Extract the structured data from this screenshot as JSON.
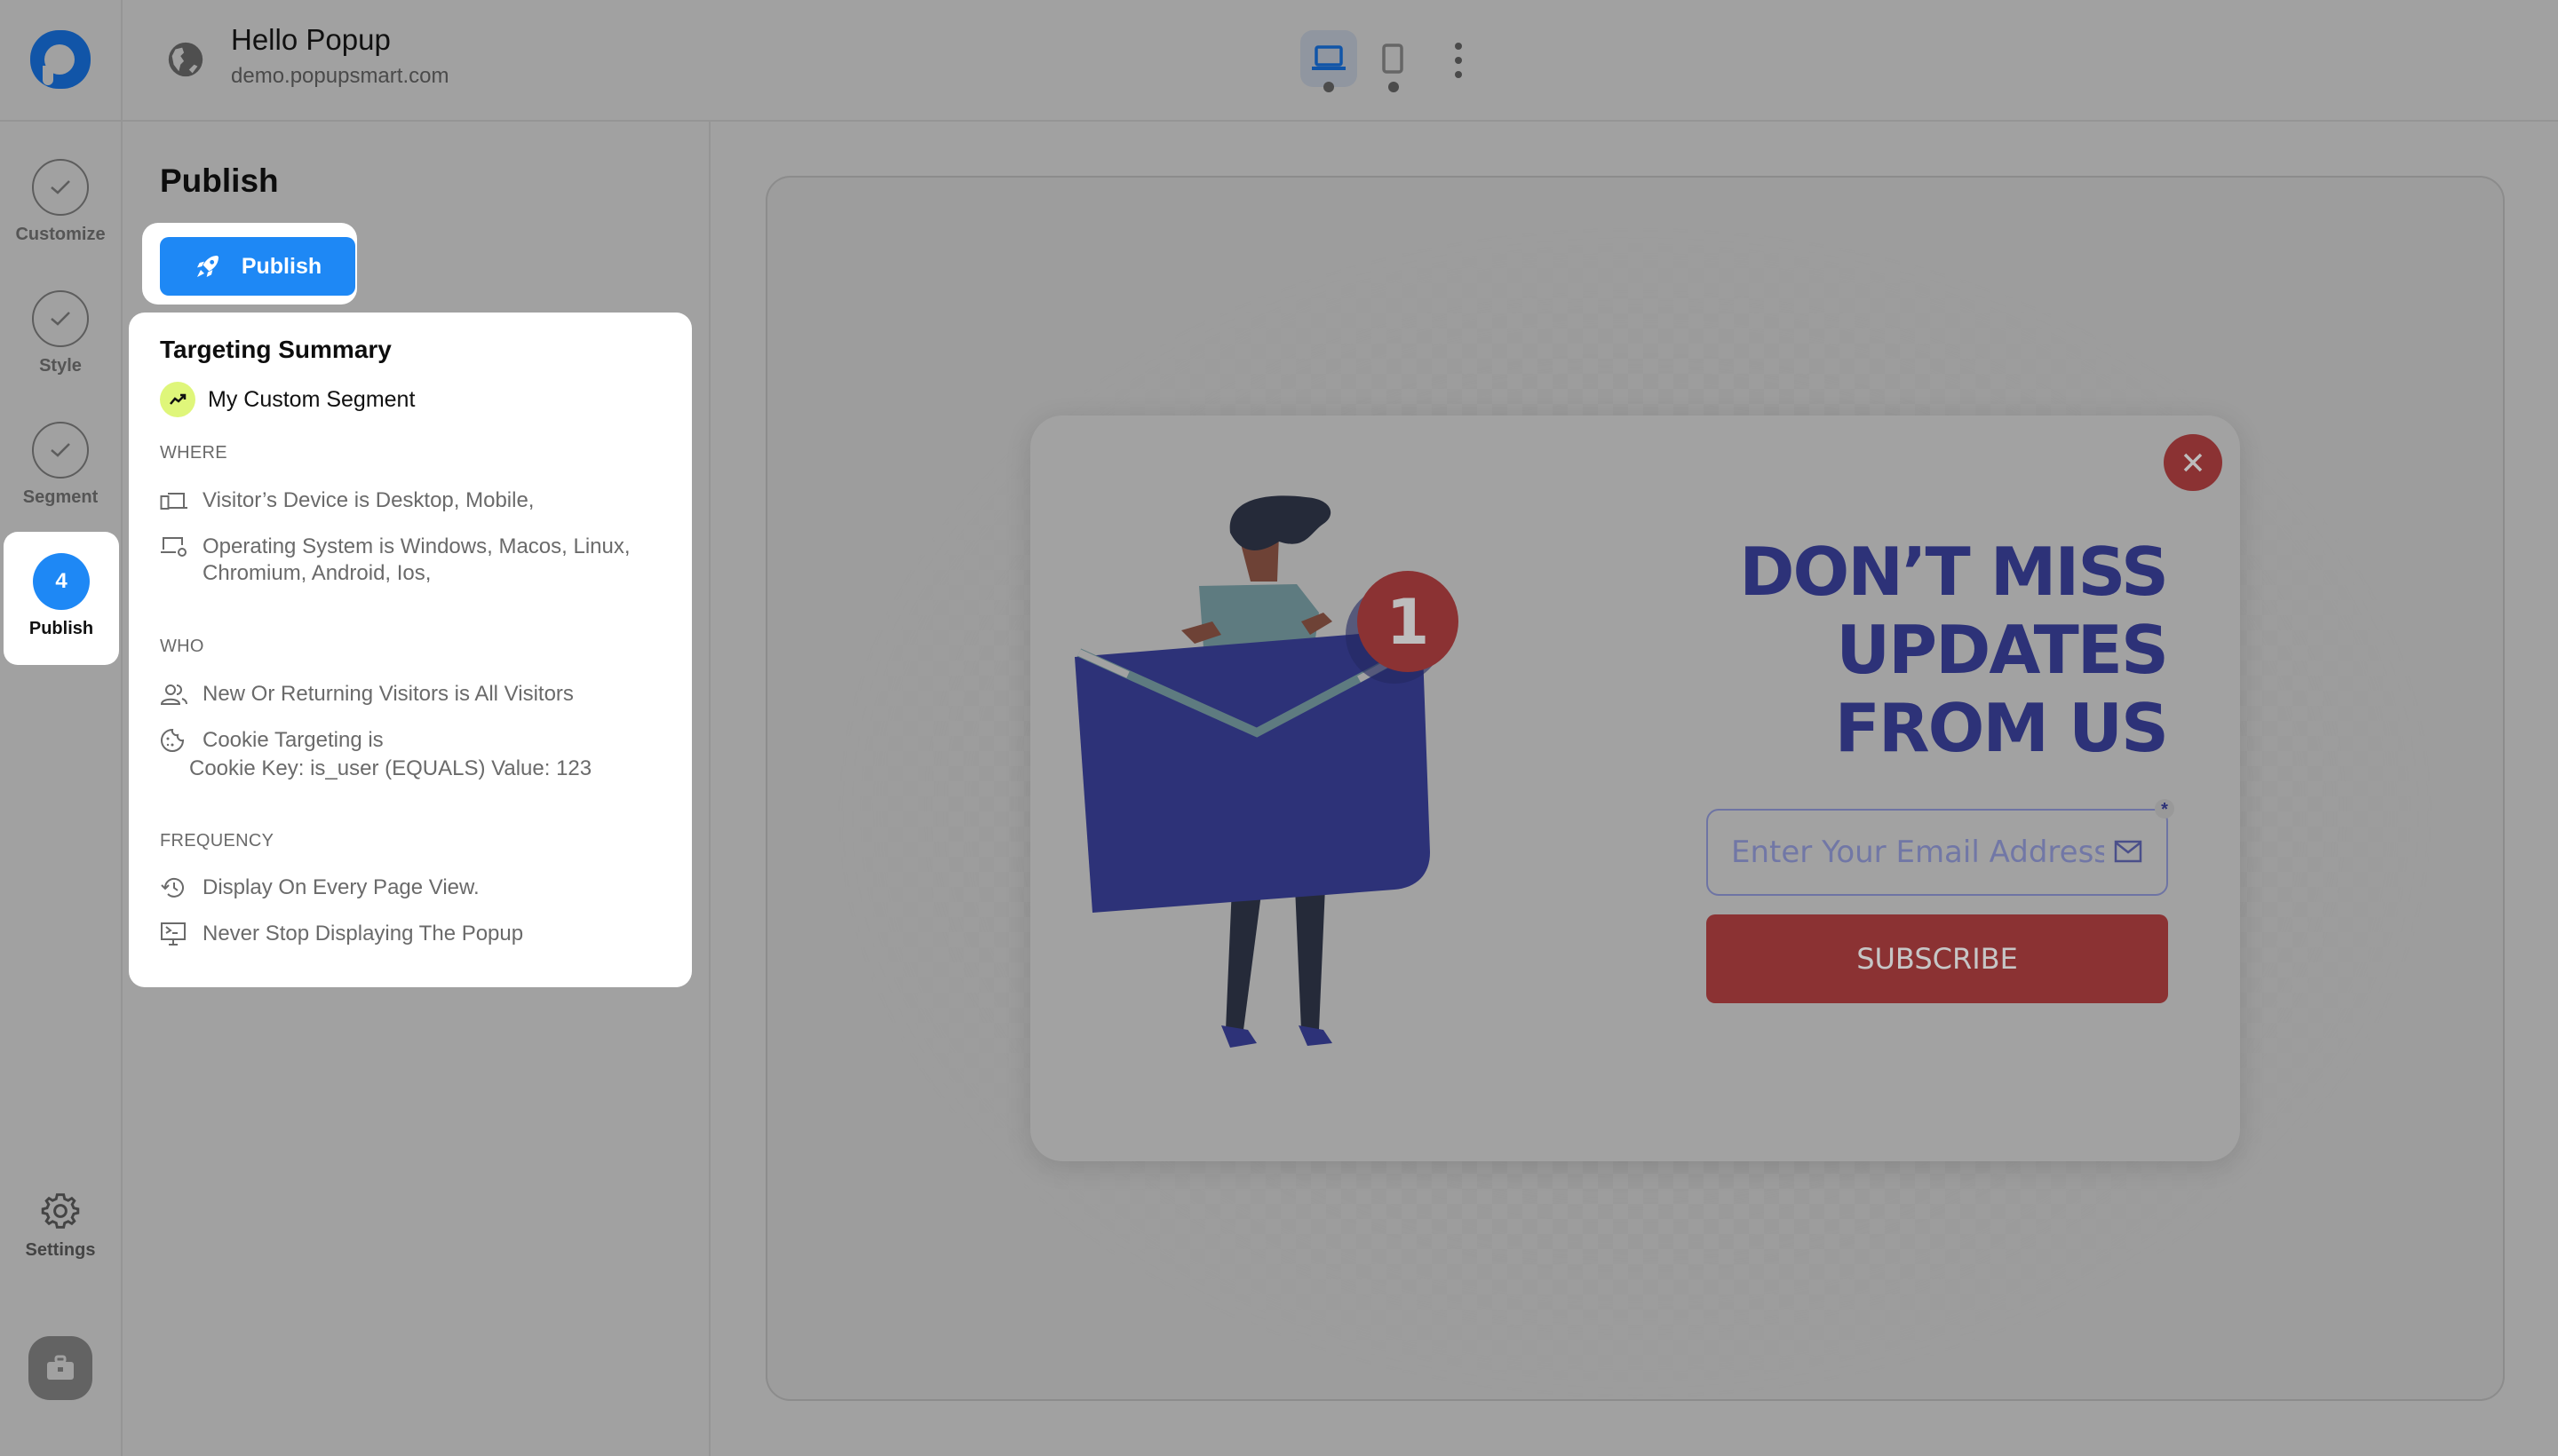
{
  "header": {
    "title": "Hello Popup",
    "url": "demo.popupsmart.com",
    "devices": [
      {
        "name": "desktop",
        "active": true
      },
      {
        "name": "mobile",
        "active": false
      }
    ]
  },
  "rail": {
    "steps": [
      {
        "label": "Customize",
        "state": "done"
      },
      {
        "label": "Style",
        "state": "done"
      },
      {
        "label": "Segment",
        "state": "done"
      },
      {
        "label": "Publish",
        "state": "active",
        "number": "4"
      }
    ],
    "settings_label": "Settings"
  },
  "panel": {
    "title": "Publish",
    "publish_button": "Publish",
    "summary": {
      "title": "Targeting Summary",
      "segment": "My Custom Segment",
      "where": {
        "heading": "WHERE",
        "items": [
          "Visitor’s Device is Desktop, Mobile,",
          "Operating System is Windows, Macos, Linux,",
          "Chromium, Android, Ios,"
        ]
      },
      "who": {
        "heading": "WHO",
        "items": [
          "New Or Returning Visitors is All Visitors",
          "Cookie Targeting is",
          "Cookie Key: is_user (EQUALS) Value: 123"
        ]
      },
      "frequency": {
        "heading": "FREQUENCY",
        "items": [
          "Display On Every Page View.",
          "Never Stop Displaying The Popup"
        ]
      }
    }
  },
  "popup": {
    "headline": [
      "DON’T MISS",
      "UPDATES",
      "FROM US"
    ],
    "email_placeholder": "Enter Your Email Address",
    "required_marker": "*",
    "subscribe_label": "SUBSCRIBE",
    "badge_count": "1",
    "colors": {
      "headline": "#2d3278",
      "button": "#8b3233",
      "accent": "#1e88f5"
    }
  }
}
